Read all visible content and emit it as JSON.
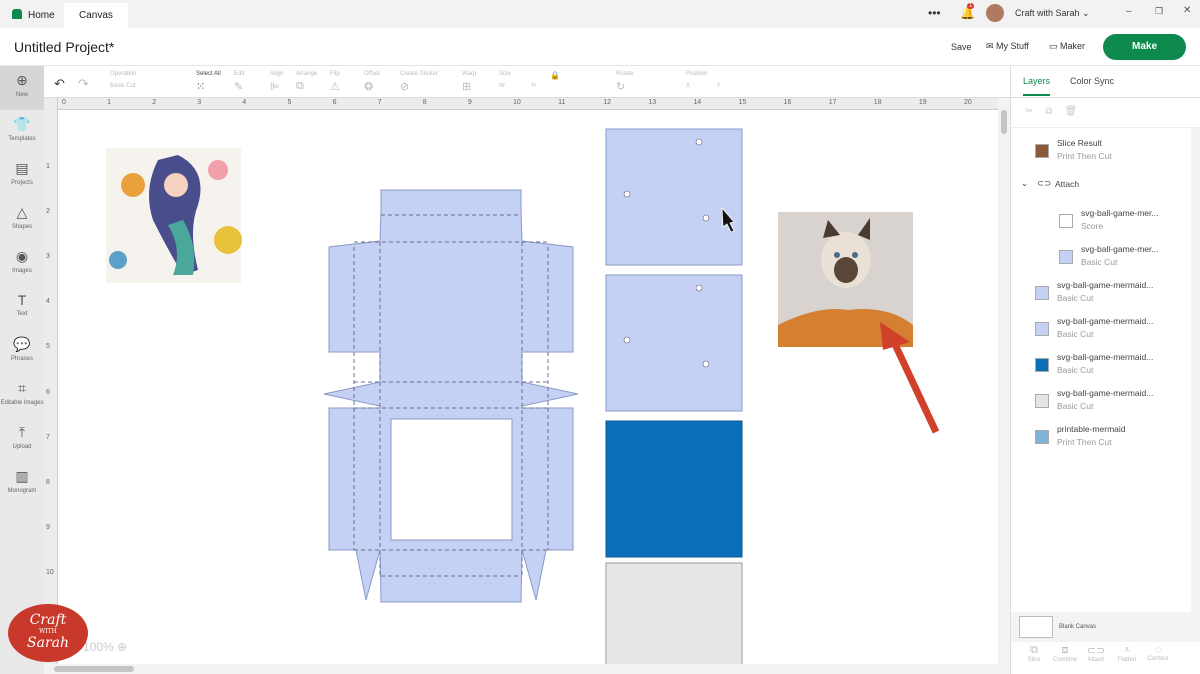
{
  "tabs": {
    "home": "Home",
    "canvas": "Canvas"
  },
  "topbar": {
    "notification_count": "1",
    "user_name": "Craft with Sarah"
  },
  "header": {
    "title": "Untitled Project*",
    "save": "Save",
    "my_stuff": "My Stuff",
    "maker": "Maker",
    "make": "Make"
  },
  "toolbar": {
    "operation": "Operation",
    "operation_value": "Basic Cut",
    "select_all": "Select All",
    "edit": "Edit",
    "align": "Align",
    "arrange": "Arrange",
    "flip": "Flip",
    "offset": "Offset",
    "create_sticker": "Create Sticker",
    "warp": "Warp",
    "size": "Size",
    "size_w": "W",
    "size_h": "H",
    "rotate": "Rotate",
    "position": "Position",
    "pos_x": "X",
    "pos_y": "Y"
  },
  "sidebar": [
    {
      "label": "New",
      "icon": "⊕"
    },
    {
      "label": "Templates",
      "icon": "👕"
    },
    {
      "label": "Projects",
      "icon": "▤"
    },
    {
      "label": "Shapes",
      "icon": "△"
    },
    {
      "label": "Images",
      "icon": "◉"
    },
    {
      "label": "Text",
      "icon": "T"
    },
    {
      "label": "Phrases",
      "icon": "💬"
    },
    {
      "label": "Editable Images",
      "icon": "⌗"
    },
    {
      "label": "Upload",
      "icon": "⤒"
    },
    {
      "label": "Monogram",
      "icon": "▥"
    }
  ],
  "ruler_h": [
    "0",
    "1",
    "2",
    "3",
    "4",
    "5",
    "6",
    "7",
    "8",
    "9",
    "10",
    "11",
    "12",
    "13",
    "14",
    "15",
    "16",
    "17",
    "18",
    "19",
    "20"
  ],
  "ruler_v": [
    "1",
    "2",
    "3",
    "4",
    "5",
    "6",
    "7",
    "8",
    "9",
    "10"
  ],
  "zoom": "100%",
  "logo": {
    "line1": "Craft",
    "line2": "WITH",
    "line3": "Sarah"
  },
  "panel": {
    "tab_layers": "Layers",
    "tab_color_sync": "Color Sync",
    "blank_canvas": "Blank Canvas",
    "layers": [
      {
        "name": "Slice Result",
        "op": "Print Then Cut",
        "color": "#8a5a3a"
      },
      {
        "name": "Attach",
        "op": ""
      },
      {
        "name": "svg-ball-game-mer...",
        "op": "Score",
        "color": "#ffffff"
      },
      {
        "name": "svg-ball-game-mer...",
        "op": "Basic Cut",
        "color": "#c5d0f5"
      },
      {
        "name": "svg-ball-game-mermaid...",
        "op": "Basic Cut",
        "color": "#c5d0f5"
      },
      {
        "name": "svg-ball-game-mermaid...",
        "op": "Basic Cut",
        "color": "#c5d0f5"
      },
      {
        "name": "svg-ball-game-mermaid...",
        "op": "Basic Cut",
        "color": "#0b6fb8"
      },
      {
        "name": "svg-ball-game-mermaid...",
        "op": "Basic Cut",
        "color": "#e4e4e4"
      },
      {
        "name": "printable-mermaid",
        "op": "Print Then Cut",
        "color": "#7fb3d8"
      }
    ],
    "bottom": [
      "Slice",
      "Combine",
      "Attach",
      "Flatten",
      "Contour"
    ]
  },
  "colors": {
    "accent": "#0e8a4f",
    "cut_blue": "#c5d0f5",
    "dark_blue": "#0b6fb8",
    "arrow": "#d0402a"
  }
}
